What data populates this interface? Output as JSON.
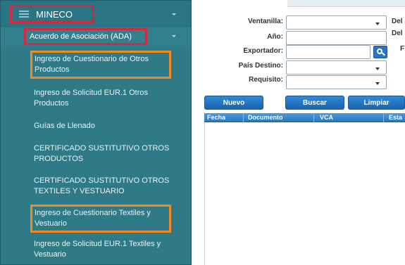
{
  "sidebar": {
    "title": "MINECO",
    "submenu": "Acuerdo de Asociación (ADA)",
    "items": [
      "Ingreso de Cuestionario de Otros Productos",
      "Ingreso de Solicitud EUR.1 Otros Productos",
      "Guías de Llenado",
      "CERTIFICADO SUSTITUTIVO OTROS PRODUCTOS",
      "CERTIFICADO SUSTITUTIVO OTROS TEXTILES Y VESTUARIO",
      "Ingreso de Cuestionario Textiles y Vestuario",
      "Ingreso de Solicitud EUR.1 Textiles y Vestuario"
    ]
  },
  "form": {
    "ventanilla_label": "Ventanilla:",
    "anio_label": "Año:",
    "exportador_label": "Exportador:",
    "pais_label": "País Destino:",
    "requisito_label": "Requisito:",
    "del_label_1": "Del",
    "del_label_2": "Del",
    "f_label": "F"
  },
  "buttons": {
    "nuevo": "Nuevo",
    "buscar": "Buscar",
    "limpiar": "Limpiar"
  },
  "grid": {
    "columns": [
      "Fecha",
      "Documento",
      "VCA",
      "Esta"
    ]
  },
  "colors": {
    "sidebar_bg": "#2f7a87",
    "red_highlight": "#d6273f",
    "orange_highlight": "#f08a24",
    "button_blue": "#1b63b0"
  }
}
